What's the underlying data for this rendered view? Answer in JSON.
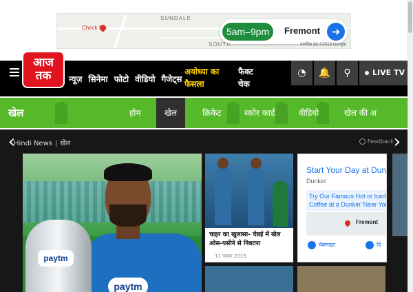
{
  "ad_top": {
    "map_labels": [
      "SUNDALE",
      "SOUTH"
    ],
    "place_label": "Check Ins",
    "hours": "5am–9pm",
    "location": "Fremont",
    "copyright": "मानचित्र डेटा ©2019 Google"
  },
  "header": {
    "logo_line1": "आज",
    "logo_line2": "तक",
    "nav": [
      "न्यूज़",
      "सिनेमा",
      "फोटो",
      "वीडियो",
      "गैजेट्स"
    ],
    "highlight": "अयोध्या का फैसला",
    "fact_check": "फैक्ट चेक",
    "live_tv": "LIVE TV",
    "icons": [
      "menu-icon",
      "speedometer-icon",
      "bell-icon",
      "search-icon"
    ]
  },
  "section": {
    "title": "खेल",
    "tabs": [
      "होम",
      "खेल",
      "क्रिकेट",
      "स्कोर कार्ड",
      "वीडियो",
      "खेल की अ"
    ],
    "active_tab": "खेल",
    "accent": "#55b92a"
  },
  "breadcrumb": {
    "home": "Hindi News",
    "current": "खेल"
  },
  "feedback": "Feedback",
  "main_story": {
    "jersey_text": "paytm"
  },
  "card": {
    "title": "चाहर का खुलासा- चेन्नई में खेल ओस-पसीने से निबटना",
    "date": "11 नवंबर 2019"
  },
  "ad_side": {
    "title": "Start Your Day at Dunkin'",
    "brand": "Dunkin'",
    "body": "Try Our Famous Hot or Iced Coffee at a Dunkin' Near You.",
    "location": "Fremont",
    "action1": "वेबसाइट",
    "action2": "दि"
  }
}
